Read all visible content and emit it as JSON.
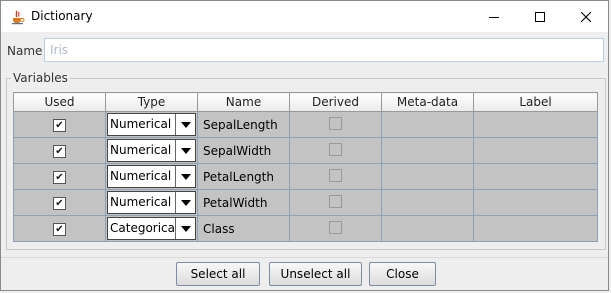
{
  "window": {
    "title": "Dictionary",
    "icon": "coffee-cup-icon",
    "controls": [
      "minimize-icon",
      "maximize-icon",
      "close-icon"
    ]
  },
  "name_field": {
    "label": "Name",
    "value": "",
    "placeholder": "Iris"
  },
  "variables": {
    "title": "Variables",
    "columns": [
      "Used",
      "Type",
      "Name",
      "Derived",
      "Meta-data",
      "Label"
    ],
    "rows": [
      {
        "used": true,
        "type": "Numerical",
        "name": "SepalLength",
        "derived": false,
        "metadata": "",
        "label": ""
      },
      {
        "used": true,
        "type": "Numerical",
        "name": "SepalWidth",
        "derived": false,
        "metadata": "",
        "label": ""
      },
      {
        "used": true,
        "type": "Numerical",
        "name": "PetalLength",
        "derived": false,
        "metadata": "",
        "label": ""
      },
      {
        "used": true,
        "type": "Numerical",
        "name": "PetalWidth",
        "derived": false,
        "metadata": "",
        "label": ""
      },
      {
        "used": true,
        "type": "Categorical",
        "name": "Class",
        "derived": false,
        "metadata": "",
        "label": ""
      }
    ]
  },
  "buttons": {
    "select_all": "Select all",
    "unselect_all": "Unselect all",
    "close": "Close"
  },
  "colors": {
    "cell_bg": "#c3c3c3",
    "input_border": "#b8cfe5",
    "button_border": "#7a8ea8"
  }
}
